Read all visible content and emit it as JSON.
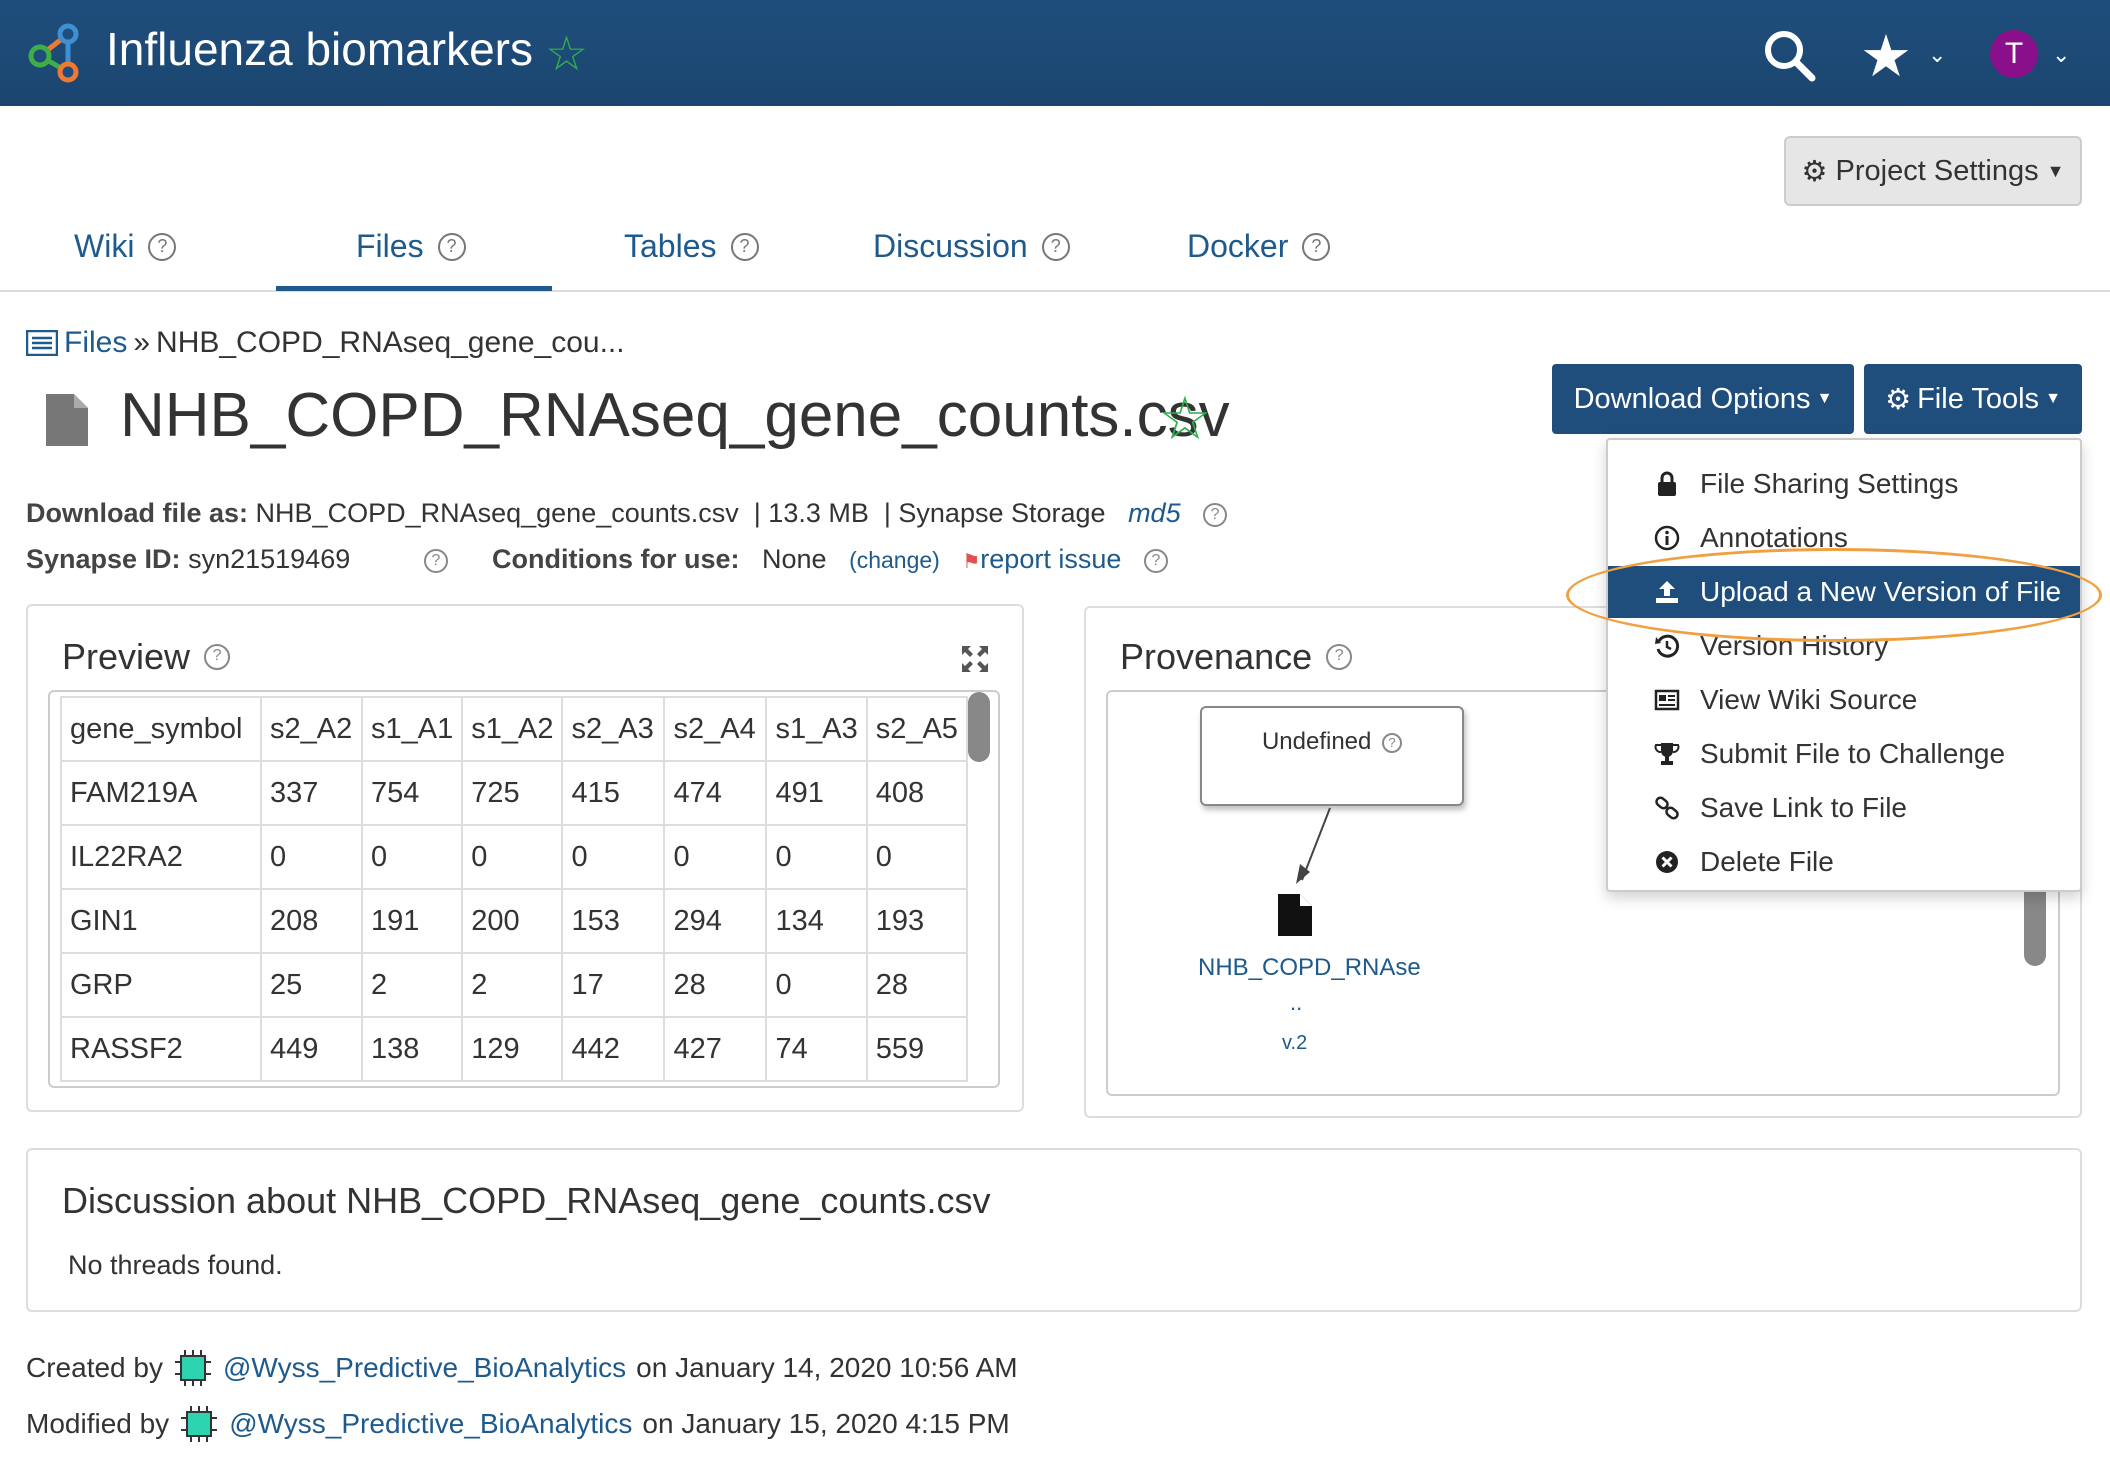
{
  "header": {
    "app_title": "Influenza biomarkers",
    "avatar_initial": "T",
    "brand_color": "#1f4e7c"
  },
  "project_settings_label": "Project Settings",
  "tabs": [
    {
      "label": "Wiki"
    },
    {
      "label": "Files",
      "active": true
    },
    {
      "label": "Tables"
    },
    {
      "label": "Discussion"
    },
    {
      "label": "Docker"
    }
  ],
  "breadcrumb": {
    "root": "Files",
    "separator": "»",
    "current": "NHB_COPD_RNAseq_gene_cou..."
  },
  "file": {
    "title": "NHB_COPD_RNAseq_gene_counts.csv",
    "download_as_label": "Download file as:",
    "download_as_value": "NHB_COPD_RNAseq_gene_counts.csv",
    "size": "| 13.3 MB",
    "storage": "| Synapse Storage",
    "md5": "md5",
    "synapse_id_label": "Synapse ID:",
    "synapse_id": "syn21519469",
    "conditions_label": "Conditions for use:",
    "conditions_value": "None",
    "change_link": "(change)",
    "report_issue": "report issue"
  },
  "buttons": {
    "download_options": "Download Options",
    "file_tools": "File Tools"
  },
  "file_tools_menu": [
    {
      "label": "File Sharing Settings",
      "icon": "lock-icon"
    },
    {
      "label": "Annotations",
      "icon": "info-icon"
    },
    {
      "label": "Upload a New Version of File",
      "icon": "upload-icon",
      "active": true
    },
    {
      "label": "Version History",
      "icon": "history-icon"
    },
    {
      "label": "View Wiki Source",
      "icon": "newspaper-icon"
    },
    {
      "label": "Submit File to Challenge",
      "icon": "trophy-icon"
    },
    {
      "label": "Save Link to File",
      "icon": "link-icon"
    },
    {
      "label": "Delete File",
      "icon": "delete-icon"
    }
  ],
  "preview": {
    "title": "Preview",
    "columns": [
      "gene_symbol",
      "s2_A2",
      "s1_A1",
      "s1_A2",
      "s2_A3",
      "s2_A4",
      "s1_A3",
      "s2_A5"
    ],
    "rows": [
      [
        "FAM219A",
        "337",
        "754",
        "725",
        "415",
        "474",
        "491",
        "408"
      ],
      [
        "IL22RA2",
        "0",
        "0",
        "0",
        "0",
        "0",
        "0",
        "0"
      ],
      [
        "GIN1",
        "208",
        "191",
        "200",
        "153",
        "294",
        "134",
        "193"
      ],
      [
        "GRP",
        "25",
        "2",
        "2",
        "17",
        "28",
        "0",
        "28"
      ],
      [
        "RASSF2",
        "449",
        "138",
        "129",
        "442",
        "427",
        "74",
        "559"
      ]
    ]
  },
  "provenance": {
    "title": "Provenance",
    "activity_label": "Undefined",
    "entity_name": "NHB_COPD_RNAse",
    "entity_dots": "..",
    "entity_version": "v.2"
  },
  "discussion": {
    "title": "Discussion about NHB_COPD_RNAseq_gene_counts.csv",
    "empty_text": "No threads found."
  },
  "footer": {
    "created_label": "Created by",
    "created_user": "@Wyss_Predictive_BioAnalytics",
    "created_on": "on January 14, 2020 10:56 AM",
    "modified_label": "Modified by",
    "modified_user": "@Wyss_Predictive_BioAnalytics",
    "modified_on": "on January 15, 2020 4:15 PM"
  },
  "colors": {
    "accent": "#1f4e7c",
    "star_green": "#2fb04c",
    "highlight": "#f0a040",
    "avatar": "#8a0f8a"
  }
}
